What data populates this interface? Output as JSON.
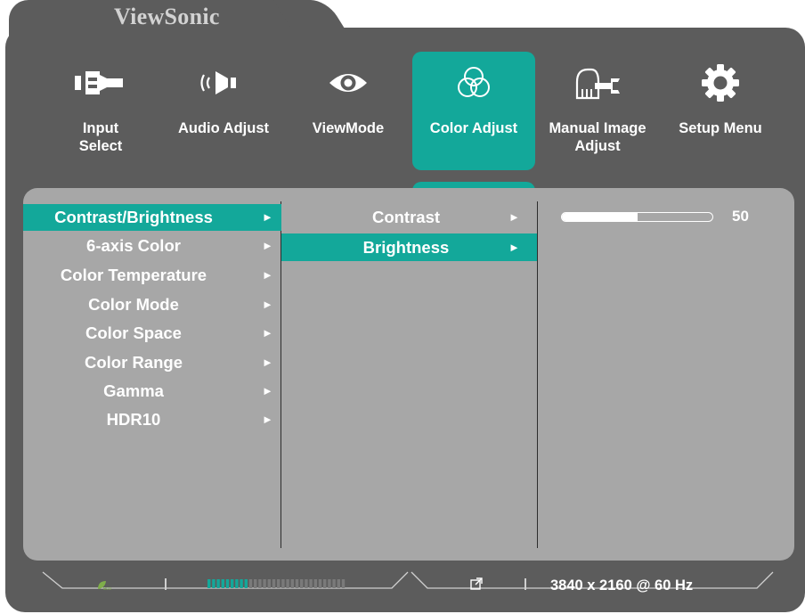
{
  "brand": "ViewSonic",
  "colors": {
    "accent": "#13a89a",
    "panel": "#5c5c5c",
    "content": "#a7a7a7",
    "text": "#ffffff"
  },
  "tabs": [
    {
      "label": "Input\nSelect",
      "icon": "input-select-icon",
      "active": false
    },
    {
      "label": "Audio Adjust",
      "icon": "speaker-icon",
      "active": false
    },
    {
      "label": "ViewMode",
      "icon": "eye-icon",
      "active": false
    },
    {
      "label": "Color Adjust",
      "icon": "color-circles-icon",
      "active": true
    },
    {
      "label": "Manual Image\nAdjust",
      "icon": "hand-wrench-icon",
      "active": false
    },
    {
      "label": "Setup Menu",
      "icon": "gear-icon",
      "active": false
    }
  ],
  "menu": {
    "items": [
      {
        "label": "Contrast/Brightness",
        "arrow": "►",
        "selected": true
      },
      {
        "label": "6-axis Color",
        "arrow": "►",
        "selected": false
      },
      {
        "label": "Color Temperature",
        "arrow": "►",
        "selected": false
      },
      {
        "label": "Color Mode",
        "arrow": "►",
        "selected": false
      },
      {
        "label": "Color Space",
        "arrow": "►",
        "selected": false
      },
      {
        "label": "Color Range",
        "arrow": "►",
        "selected": false
      },
      {
        "label": "Gamma",
        "arrow": "►",
        "selected": false
      },
      {
        "label": "HDR10",
        "arrow": "►",
        "selected": false
      }
    ]
  },
  "submenu": {
    "items": [
      {
        "label": "Contrast",
        "arrow": "►",
        "selected": false
      },
      {
        "label": "Brightness",
        "arrow": "►",
        "selected": true
      }
    ]
  },
  "slider": {
    "value_label": "50",
    "value": 50,
    "min": 0,
    "max": 100,
    "fill_fraction": 0.5
  },
  "status": {
    "eco_icon": "eco-leaf-icon",
    "level_segments_total": 30,
    "level_segments_filled": 9,
    "link_icon": "external-link-icon",
    "resolution": "3840 x 2160 @ 60 Hz"
  }
}
